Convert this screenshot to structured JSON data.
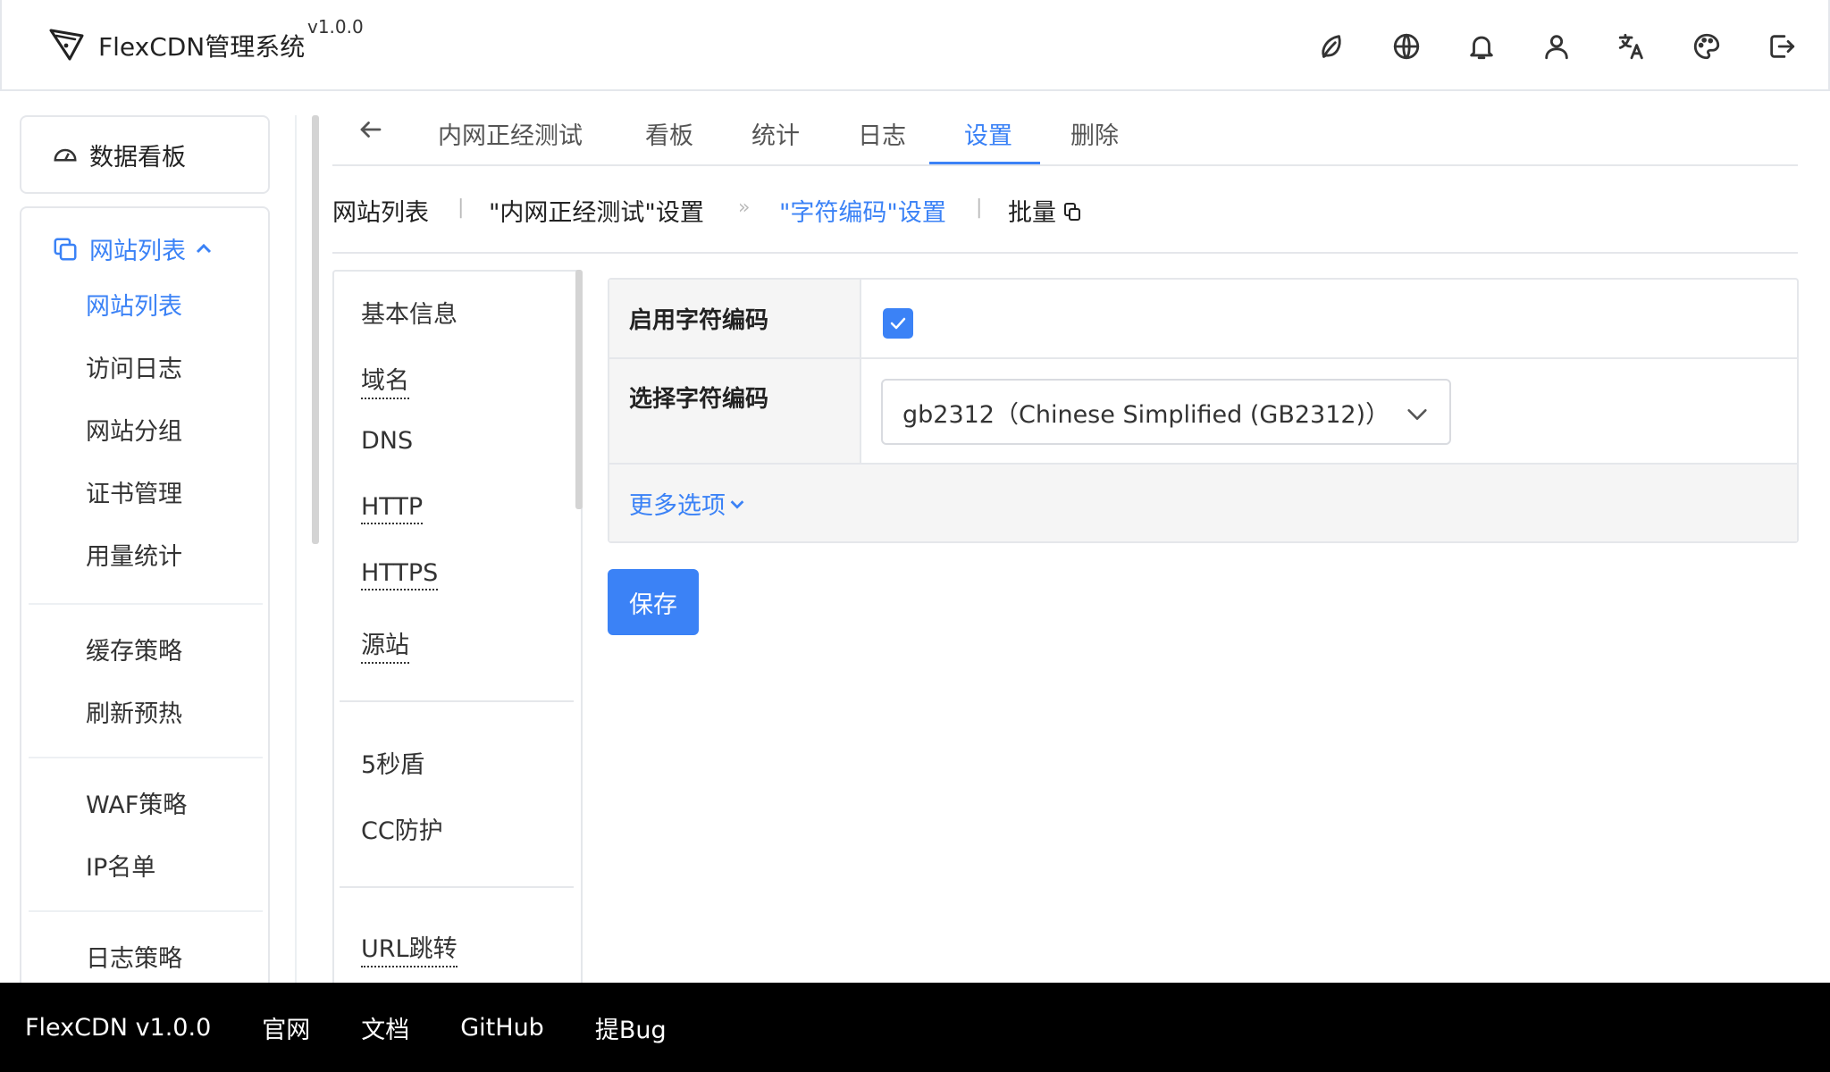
{
  "header": {
    "app_name": "FlexCDN管理系统",
    "version": "v1.0.0",
    "icons": [
      "leaf-icon",
      "globe-icon",
      "bell-icon",
      "user-icon",
      "translate-icon",
      "palette-icon",
      "logout-icon"
    ]
  },
  "sidebar": {
    "dashboard_label": "数据看板",
    "section_label": "网站列表",
    "items": [
      {
        "label": "网站列表",
        "active": true
      },
      {
        "label": "访问日志"
      },
      {
        "label": "网站分组"
      },
      {
        "label": "证书管理"
      },
      {
        "label": "用量统计"
      },
      {
        "label": "缓存策略"
      },
      {
        "label": "刷新预热"
      },
      {
        "label": "WAF策略"
      },
      {
        "label": "IP名单"
      },
      {
        "label": "日志策略"
      }
    ]
  },
  "tabs": {
    "items": [
      {
        "label": "内网正经测试"
      },
      {
        "label": "看板"
      },
      {
        "label": "统计"
      },
      {
        "label": "日志"
      },
      {
        "label": "设置",
        "active": true
      },
      {
        "label": "删除"
      }
    ]
  },
  "breadcrumb": {
    "root": "网站列表",
    "site_settings": "\"内网正经测试\"设置",
    "separator": "»",
    "current": "\"字符编码\"设置",
    "batch": "批量"
  },
  "submenu": {
    "items": [
      {
        "label": "基本信息"
      },
      {
        "label": "域名"
      },
      {
        "label": "DNS"
      },
      {
        "label": "HTTP"
      },
      {
        "label": "HTTPS"
      },
      {
        "label": "源站"
      },
      {
        "label": "5秒盾"
      },
      {
        "label": "CC防护"
      },
      {
        "label": "URL跳转"
      }
    ]
  },
  "form": {
    "enable_label": "启用字符编码",
    "enable_checked": true,
    "select_label": "选择字符编码",
    "select_value": "gb2312（Chinese Simplified (GB2312)）",
    "more_options": "更多选项",
    "save_label": "保存"
  },
  "footer": {
    "product": "FlexCDN v1.0.0",
    "links": [
      "官网",
      "文档",
      "GitHub",
      "提Bug"
    ]
  },
  "colors": {
    "accent": "#3b82f6",
    "footer_bg": "#000000"
  }
}
